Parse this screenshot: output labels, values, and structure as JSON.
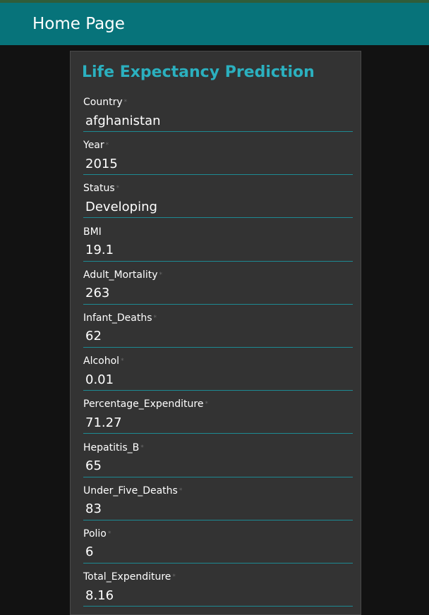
{
  "navbar": {
    "title": "Home Page"
  },
  "form": {
    "title": "Life Expectancy Prediction",
    "required_mark": "*",
    "fields": [
      {
        "label": "Country",
        "value": "afghanistan"
      },
      {
        "label": "Year",
        "value": "2015"
      },
      {
        "label": "Status",
        "value": "Developing"
      },
      {
        "label": "BMI",
        "value": "19.1"
      },
      {
        "label": "Adult_Mortality",
        "value": "263"
      },
      {
        "label": "Infant_Deaths",
        "value": "62"
      },
      {
        "label": "Alcohol",
        "value": "0.01"
      },
      {
        "label": "Percentage_Expenditure",
        "value": "71.27"
      },
      {
        "label": "Hepatitis_B",
        "value": "65"
      },
      {
        "label": "Under_Five_Deaths",
        "value": "83"
      },
      {
        "label": "Polio",
        "value": "6"
      },
      {
        "label": "Total_Expenditure",
        "value": "8.16"
      }
    ]
  }
}
